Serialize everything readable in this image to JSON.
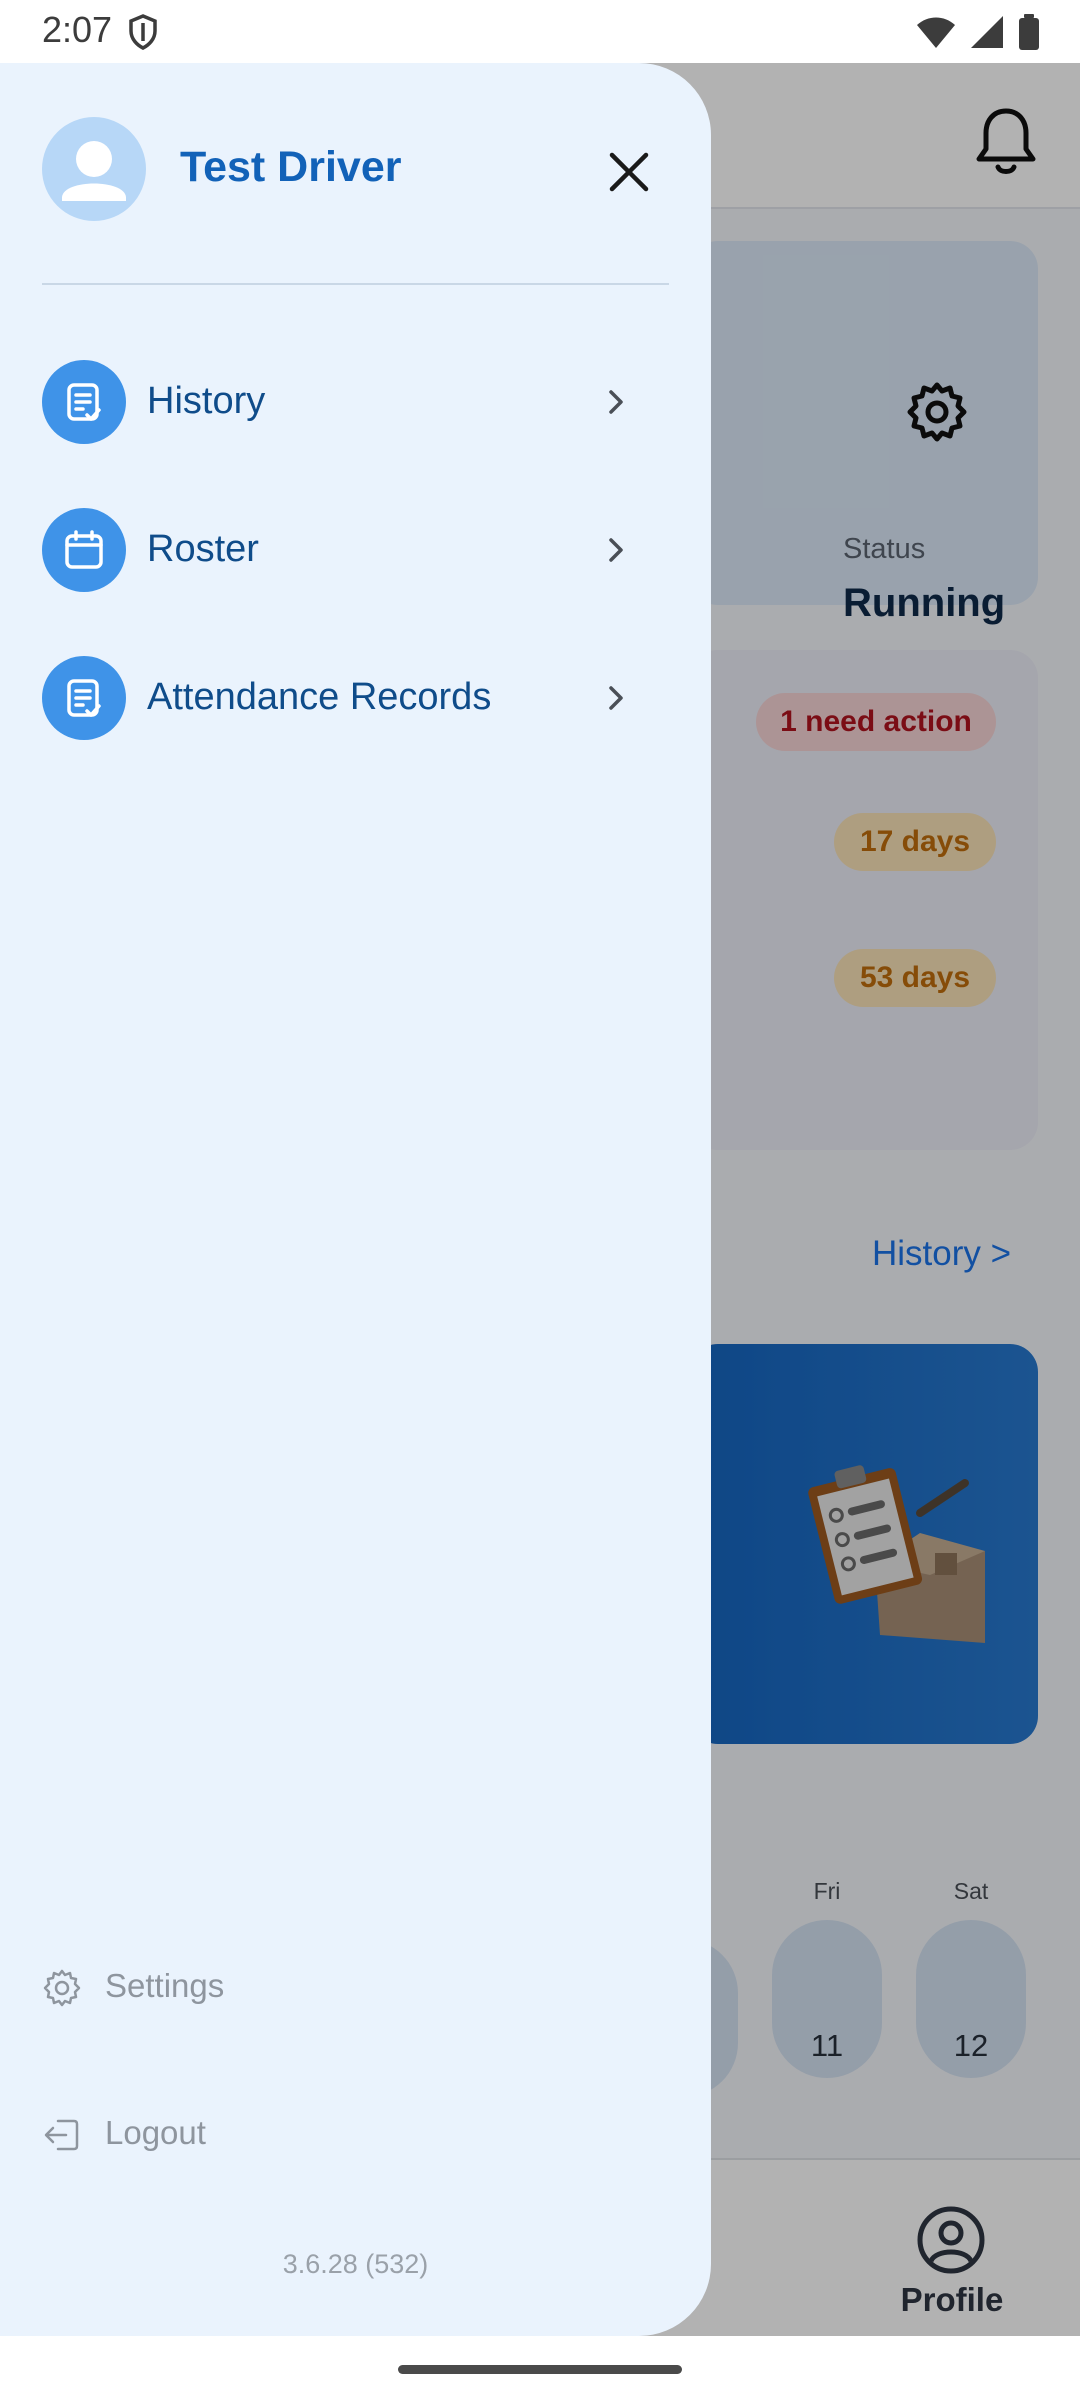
{
  "status_bar": {
    "time": "2:07",
    "icons": [
      "shield-icon",
      "wifi-icon",
      "cellular-signal-icon",
      "battery-icon"
    ]
  },
  "background_app": {
    "header_icons": [
      "bell-icon"
    ],
    "status_card": {
      "label": "Status",
      "value": "Running",
      "icon": "gear-icon"
    },
    "documents_card": {
      "badges": [
        "1 need action",
        "17 days",
        "53 days"
      ]
    },
    "history_link": "History >",
    "calendar": {
      "days": [
        {
          "label": "Fri",
          "number": "11"
        },
        {
          "label": "Sat",
          "number": "12"
        }
      ]
    },
    "bottom_nav": {
      "profile_label": "Profile"
    }
  },
  "drawer": {
    "user_name": "Test Driver",
    "menu": [
      {
        "label": "History",
        "icon": "document-check-icon"
      },
      {
        "label": "Roster",
        "icon": "calendar-icon"
      },
      {
        "label": "Attendance Records",
        "icon": "document-check-icon"
      }
    ],
    "footer": {
      "settings_label": "Settings",
      "logout_label": "Logout",
      "version": "3.6.28 (532)"
    }
  },
  "colors": {
    "drawer_bg": "#eaf3fd",
    "accent": "#3f93e8",
    "name_text": "#1262b8",
    "menu_text": "#0f4c8a",
    "badge_red_bg": "#f7d4d6",
    "badge_red_text": "#b0141f",
    "badge_amber_bg": "#f9e3b8",
    "badge_amber_text": "#c06d0c"
  }
}
